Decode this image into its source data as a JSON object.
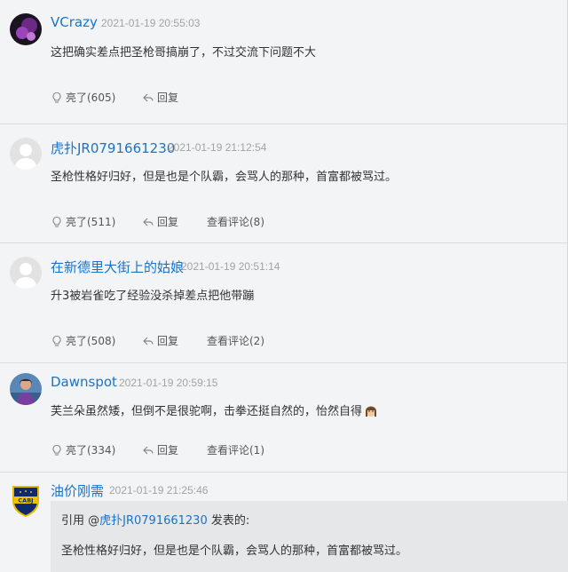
{
  "comments": [
    {
      "username": "VCrazy",
      "time": "2021-01-19 20:55:03",
      "text": "这把确实差点把圣枪哥搞崩了，不过交流下问题不大",
      "like_label": "亮了(605)",
      "reply_label": "回复",
      "avatar_icon": "purple-avatar"
    },
    {
      "username": "虎扑JR0791661230",
      "time": "2021-01-19 21:12:54",
      "text": "圣枪性格好归好，但是也是个队霸，会骂人的那种，首富都被骂过。",
      "like_label": "亮了(511)",
      "reply_label": "回复",
      "view_label": "查看评论(8)",
      "avatar_icon": "default-avatar"
    },
    {
      "username": "在新德里大街上的姑娘",
      "time": "2021-01-19 20:51:14",
      "text": "升3被岩雀吃了经验没杀掉差点把他带蹦",
      "like_label": "亮了(508)",
      "reply_label": "回复",
      "view_label": "查看评论(2)",
      "avatar_icon": "default-avatar"
    },
    {
      "username": "Dawnspot",
      "time": "2021-01-19 20:59:15",
      "text": "芙兰朵虽然矮，但倒不是很驼啊，击拳还挺自然的，怡然自得",
      "like_label": "亮了(334)",
      "reply_label": "回复",
      "view_label": "查看评论(1)",
      "avatar_icon": "photo-avatar"
    },
    {
      "username": "油价刚需",
      "time": "2021-01-19 21:25:46",
      "avatar_icon": "cabj-badge-avatar",
      "avatar_text": "CABJ",
      "quote": {
        "prefix": "引用 @",
        "user": "虎扑JR0791661230",
        "suffix": " 发表的:",
        "text": "圣枪性格好归好，但是也是个队霸，会骂人的那种，首富都被骂过。"
      }
    }
  ],
  "colors": {
    "username": "#1a73c7",
    "time": "#a3a3a3",
    "background": "#f3f4f6",
    "quote_bg": "#e6e7e9"
  }
}
